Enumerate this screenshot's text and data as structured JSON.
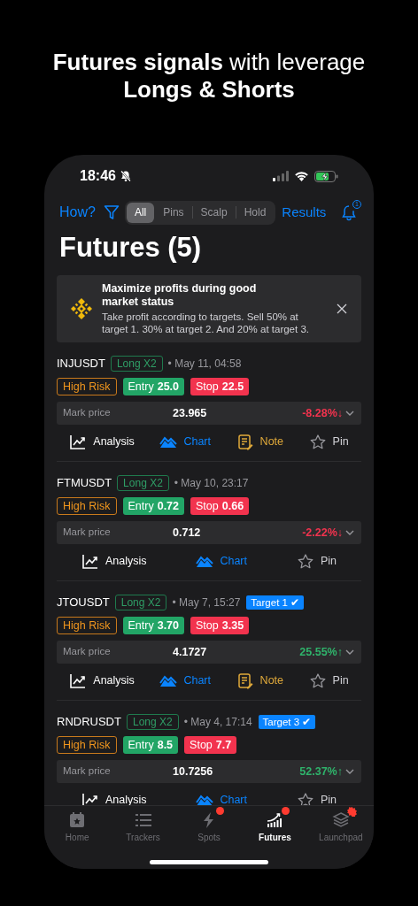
{
  "headline": {
    "line_1": "**Futures signals** with leverage",
    "line_2": "Longs & Shorts"
  },
  "status_bar": {
    "time": "18:46",
    "silent": true
  },
  "toolbar": {
    "help_link": "How?",
    "segments": [
      {
        "label": "All",
        "selected": true
      },
      {
        "label": "Pins",
        "selected": false
      },
      {
        "label": "Scalp",
        "selected": false
      },
      {
        "label": "Hold",
        "selected": false
      }
    ],
    "results_link": "Results",
    "bell_badge": "1"
  },
  "title": "Futures (5)",
  "banner": {
    "title": "Maximize profits during good market status",
    "text": "Take profit according to targets. Sell 50% at target 1. 30% at target 2. And 20% at target 3."
  },
  "signals": [
    {
      "symbol": "INJUSDT",
      "position": "Long X2",
      "time": "• May 11, 04:58",
      "risk": "High Risk",
      "entry_label": "Entry",
      "entry": "25.0",
      "stop_label": "Stop",
      "stop": "22.5",
      "mark_label": "Mark price",
      "mark_price": "23.965",
      "change": "-8.28%↓",
      "rising": false,
      "actions": [
        {
          "kind": "analysis",
          "label": "Analysis"
        },
        {
          "kind": "chart",
          "label": "Chart"
        },
        {
          "kind": "note",
          "label": "Note"
        },
        {
          "kind": "pin",
          "label": "Pin"
        }
      ]
    },
    {
      "symbol": "FTMUSDT",
      "position": "Long X2",
      "time": "• May 10, 23:17",
      "risk": "High Risk",
      "entry_label": "Entry",
      "entry": "0.72",
      "stop_label": "Stop",
      "stop": "0.66",
      "mark_label": "Mark price",
      "mark_price": "0.712",
      "change": "-2.22%↓",
      "rising": false,
      "actions": [
        {
          "kind": "analysis",
          "label": "Analysis"
        },
        {
          "kind": "chart",
          "label": "Chart"
        },
        {
          "kind": "pin",
          "label": "Pin"
        }
      ]
    },
    {
      "symbol": "JTOUSDT",
      "position": "Long X2",
      "time": "• May 7, 15:27",
      "target": "Target 1 ✔",
      "risk": "High Risk",
      "entry_label": "Entry",
      "entry": "3.70",
      "stop_label": "Stop",
      "stop": "3.35",
      "mark_label": "Mark price",
      "mark_price": "4.1727",
      "change": "25.55%↑",
      "rising": true,
      "actions": [
        {
          "kind": "analysis",
          "label": "Analysis"
        },
        {
          "kind": "chart",
          "label": "Chart"
        },
        {
          "kind": "note",
          "label": "Note"
        },
        {
          "kind": "pin",
          "label": "Pin"
        }
      ]
    },
    {
      "symbol": "RNDRUSDT",
      "position": "Long X2",
      "time": "• May 4, 17:14",
      "target": "Target 3 ✔",
      "risk": "High Risk",
      "entry_label": "Entry",
      "entry": "8.5",
      "stop_label": "Stop",
      "stop": "7.7",
      "mark_label": "Mark price",
      "mark_price": "10.7256",
      "change": "52.37%↑",
      "rising": true,
      "actions": [
        {
          "kind": "analysis",
          "label": "Analysis"
        },
        {
          "kind": "chart",
          "label": "Chart"
        },
        {
          "kind": "pin",
          "label": "Pin"
        }
      ]
    }
  ],
  "tab_bar": [
    {
      "kind": "home",
      "label": "Home",
      "selected": false
    },
    {
      "kind": "trackers",
      "label": "Trackers",
      "selected": false
    },
    {
      "kind": "spots",
      "label": "Spots",
      "selected": false,
      "dot": true
    },
    {
      "kind": "futures",
      "label": "Futures",
      "selected": true,
      "dot": true
    },
    {
      "kind": "launchpad",
      "label": "Launchpad",
      "selected": false,
      "hot": true
    }
  ]
}
